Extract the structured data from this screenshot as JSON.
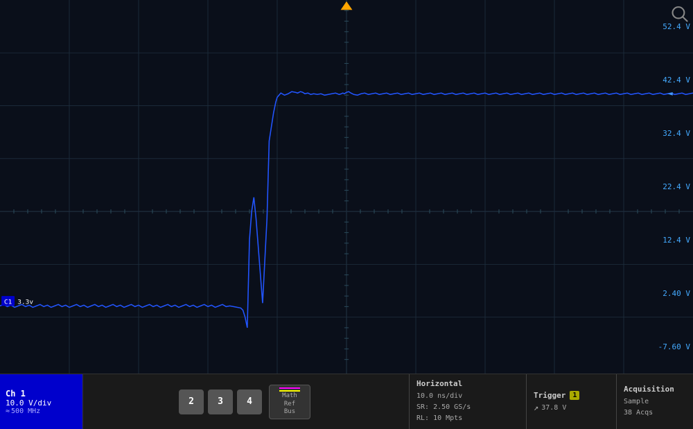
{
  "screen": {
    "background_color": "#0a0f1a",
    "grid_color": "#1a2a3a",
    "waveform_color": "#2255ff"
  },
  "voltage_labels": [
    {
      "value": "52.4 V"
    },
    {
      "value": "42.4 V"
    },
    {
      "value": "32.4 V"
    },
    {
      "value": "22.4 V"
    },
    {
      "value": "12.4 V"
    },
    {
      "value": "2.40 V"
    },
    {
      "value": "-7.60 V"
    }
  ],
  "trigger_marker": {
    "color": "orange"
  },
  "channel1": {
    "label": "C1",
    "voltage_div": "10.0 V/div",
    "bandwidth": "500 MHz",
    "value_display": "3.3v"
  },
  "bottom_bar": {
    "ch1": {
      "title": "Ch 1",
      "voltage_div": "10.0 V/div",
      "bandwidth_label": "500 MHz"
    },
    "buttons": {
      "btn2": "2",
      "btn3": "3",
      "btn4": "4",
      "math_ref_bus": "Math\nRef\nBus"
    },
    "horizontal": {
      "title": "Horizontal",
      "time_div": "10.0 ns/div",
      "sample_rate": "SR: 2.50 GS/s",
      "record_length": "RL: 10 Mpts"
    },
    "trigger": {
      "title": "Trigger",
      "badge": "1",
      "level": "37.8 V"
    },
    "acquisition": {
      "title": "Acquisition",
      "mode": "Sample",
      "acqs": "38 Acqs"
    }
  }
}
